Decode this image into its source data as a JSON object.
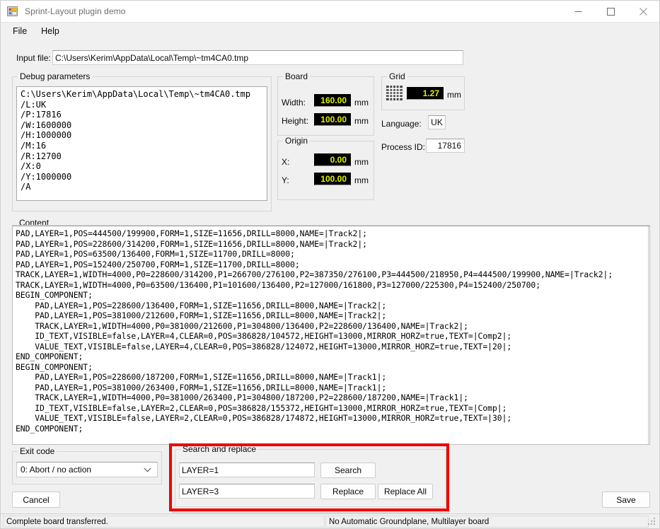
{
  "window": {
    "title": "Sprint-Layout plugin demo",
    "icon": "app-grid-icon",
    "minimize_label": "—",
    "maximize_label": "□",
    "close_label": "✕"
  },
  "menubar": {
    "items": [
      {
        "label": "File"
      },
      {
        "label": "Help"
      }
    ]
  },
  "input_file": {
    "label": "Input file:",
    "value": "C:\\Users\\Kerim\\AppData\\Local\\Temp\\~tm4CA0.tmp"
  },
  "debug": {
    "title": "Debug parameters",
    "text": "C:\\Users\\Kerim\\AppData\\Local\\Temp\\~tm4CA0.tmp\n/L:UK\n/P:17816\n/W:1600000\n/H:1000000\n/M:16\n/R:12700\n/X:0\n/Y:1000000\n/A"
  },
  "board": {
    "title": "Board",
    "width_label": "Width:",
    "width_value": "160.00",
    "width_unit": "mm",
    "height_label": "Height:",
    "height_value": "100.00",
    "height_unit": "mm"
  },
  "origin": {
    "title": "Origin",
    "x_label": "X:",
    "x_value": "0.00",
    "x_unit": "mm",
    "y_label": "Y:",
    "y_value": "100.00",
    "y_unit": "mm"
  },
  "grid": {
    "title": "Grid",
    "icon": "grid-icon",
    "value": "1.27",
    "unit": "mm"
  },
  "language": {
    "label": "Language:",
    "value": "UK"
  },
  "process": {
    "label": "Process ID:",
    "value": "17816"
  },
  "content": {
    "title": "Content",
    "text": "PAD,LAYER=1,POS=444500/199900,FORM=1,SIZE=11656,DRILL=8000,NAME=|Track2|;\nPAD,LAYER=1,POS=228600/314200,FORM=1,SIZE=11656,DRILL=8000,NAME=|Track2|;\nPAD,LAYER=1,POS=63500/136400,FORM=1,SIZE=11700,DRILL=8000;\nPAD,LAYER=1,POS=152400/250700,FORM=1,SIZE=11700,DRILL=8000;\nTRACK,LAYER=1,WIDTH=4000,P0=228600/314200,P1=266700/276100,P2=387350/276100,P3=444500/218950,P4=444500/199900,NAME=|Track2|;\nTRACK,LAYER=1,WIDTH=4000,P0=63500/136400,P1=101600/136400,P2=127000/161800,P3=127000/225300,P4=152400/250700;\nBEGIN_COMPONENT;\n    PAD,LAYER=1,POS=228600/136400,FORM=1,SIZE=11656,DRILL=8000,NAME=|Track2|;\n    PAD,LAYER=1,POS=381000/212600,FORM=1,SIZE=11656,DRILL=8000,NAME=|Track2|;\n    TRACK,LAYER=1,WIDTH=4000,P0=381000/212600,P1=304800/136400,P2=228600/136400,NAME=|Track2|;\n    ID_TEXT,VISIBLE=false,LAYER=4,CLEAR=0,POS=386828/104572,HEIGHT=13000,MIRROR_HORZ=true,TEXT=|Comp2|;\n    VALUE_TEXT,VISIBLE=false,LAYER=4,CLEAR=0,POS=386828/124072,HEIGHT=13000,MIRROR_HORZ=true,TEXT=|20|;\nEND_COMPONENT;\nBEGIN_COMPONENT;\n    PAD,LAYER=1,POS=228600/187200,FORM=1,SIZE=11656,DRILL=8000,NAME=|Track1|;\n    PAD,LAYER=1,POS=381000/263400,FORM=1,SIZE=11656,DRILL=8000,NAME=|Track1|;\n    TRACK,LAYER=1,WIDTH=4000,P0=381000/263400,P1=304800/187200,P2=228600/187200,NAME=|Track1|;\n    ID_TEXT,VISIBLE=false,LAYER=2,CLEAR=0,POS=386828/155372,HEIGHT=13000,MIRROR_HORZ=true,TEXT=|Comp|;\n    VALUE_TEXT,VISIBLE=false,LAYER=2,CLEAR=0,POS=386828/174872,HEIGHT=13000,MIRROR_HORZ=true,TEXT=|30|;\nEND_COMPONENT;"
  },
  "exit_code": {
    "title": "Exit code",
    "selected": "0: Abort / no action"
  },
  "search_replace": {
    "title": "Search and replace",
    "search_value": "LAYER=1",
    "replace_value": "LAYER=3",
    "search_button": "Search",
    "replace_button": "Replace",
    "replace_all_button": "Replace All",
    "highlight_color": "#ee0000"
  },
  "buttons": {
    "cancel": "Cancel",
    "save": "Save"
  },
  "statusbar": {
    "left": "Complete board transferred.",
    "right": "No Automatic Groundplane, Multilayer board"
  }
}
